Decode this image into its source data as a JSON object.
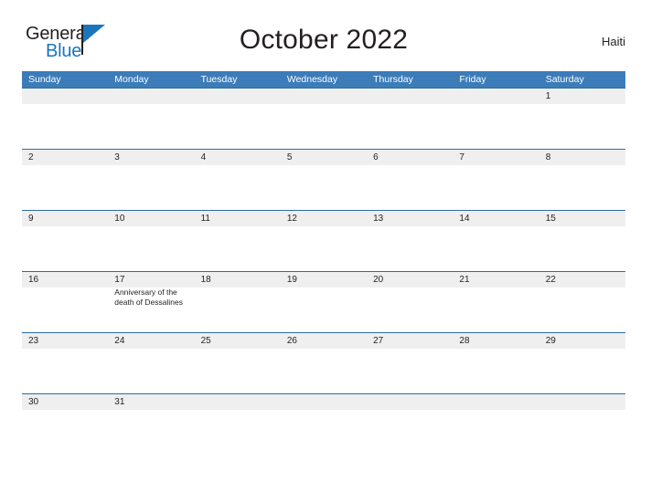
{
  "brand": {
    "logo_word_1": "General",
    "logo_word_2": "Blue",
    "logo_flag_icon": "blue-flag-icon"
  },
  "header": {
    "title": "October 2022",
    "country": "Haiti"
  },
  "calendar": {
    "month": "October",
    "year": "2022",
    "accent_blue": "#3b7cb9",
    "border_blue": "#2d6da4",
    "band_gray": "#efefef",
    "day_headers": [
      "Sunday",
      "Monday",
      "Tuesday",
      "Wednesday",
      "Thursday",
      "Friday",
      "Saturday"
    ],
    "weeks": [
      [
        {
          "num": "",
          "event": ""
        },
        {
          "num": "",
          "event": ""
        },
        {
          "num": "",
          "event": ""
        },
        {
          "num": "",
          "event": ""
        },
        {
          "num": "",
          "event": ""
        },
        {
          "num": "",
          "event": ""
        },
        {
          "num": "1",
          "event": ""
        }
      ],
      [
        {
          "num": "2",
          "event": ""
        },
        {
          "num": "3",
          "event": ""
        },
        {
          "num": "4",
          "event": ""
        },
        {
          "num": "5",
          "event": ""
        },
        {
          "num": "6",
          "event": ""
        },
        {
          "num": "7",
          "event": ""
        },
        {
          "num": "8",
          "event": ""
        }
      ],
      [
        {
          "num": "9",
          "event": ""
        },
        {
          "num": "10",
          "event": ""
        },
        {
          "num": "11",
          "event": ""
        },
        {
          "num": "12",
          "event": ""
        },
        {
          "num": "13",
          "event": ""
        },
        {
          "num": "14",
          "event": ""
        },
        {
          "num": "15",
          "event": ""
        }
      ],
      [
        {
          "num": "16",
          "event": ""
        },
        {
          "num": "17",
          "event": "Anniversary of the death of Dessalines"
        },
        {
          "num": "18",
          "event": ""
        },
        {
          "num": "19",
          "event": ""
        },
        {
          "num": "20",
          "event": ""
        },
        {
          "num": "21",
          "event": ""
        },
        {
          "num": "22",
          "event": ""
        }
      ],
      [
        {
          "num": "23",
          "event": ""
        },
        {
          "num": "24",
          "event": ""
        },
        {
          "num": "25",
          "event": ""
        },
        {
          "num": "26",
          "event": ""
        },
        {
          "num": "27",
          "event": ""
        },
        {
          "num": "28",
          "event": ""
        },
        {
          "num": "29",
          "event": ""
        }
      ],
      [
        {
          "num": "30",
          "event": ""
        },
        {
          "num": "31",
          "event": ""
        },
        {
          "num": "",
          "event": ""
        },
        {
          "num": "",
          "event": ""
        },
        {
          "num": "",
          "event": ""
        },
        {
          "num": "",
          "event": ""
        },
        {
          "num": "",
          "event": ""
        }
      ]
    ]
  }
}
